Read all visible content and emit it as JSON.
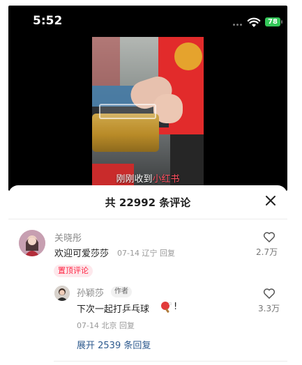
{
  "status_bar": {
    "time": "5:52",
    "battery": "78",
    "icons": [
      "signal-dots-icon",
      "wifi-icon",
      "battery-icon"
    ]
  },
  "video": {
    "caption_prefix": "刚刚收到",
    "caption_highlight": "小红书",
    "colors": {
      "highlight": "#ff4f5f"
    }
  },
  "comments_panel": {
    "title": "共 22992 条评论",
    "close_icon": "close-icon"
  },
  "comment": {
    "author": "关晓彤",
    "text": "欢迎可爱莎莎",
    "date": "07-14",
    "location": "辽宁",
    "reply_label": "回复",
    "pinned_label": "置顶评论",
    "likes": "2.7万"
  },
  "reply": {
    "author": "孙颖莎",
    "author_tag": "作者",
    "text": "下次一起打乒乓球",
    "emoji": "ping-pong-icon",
    "text_tail": "!",
    "date": "07-14",
    "location": "北京",
    "reply_label": "回复",
    "likes": "3.3万"
  },
  "expand": {
    "label": "展开 2539 条回复"
  },
  "colors": {
    "accent": "#ff2442",
    "link": "#2d5a8e",
    "battery": "#34c759"
  }
}
